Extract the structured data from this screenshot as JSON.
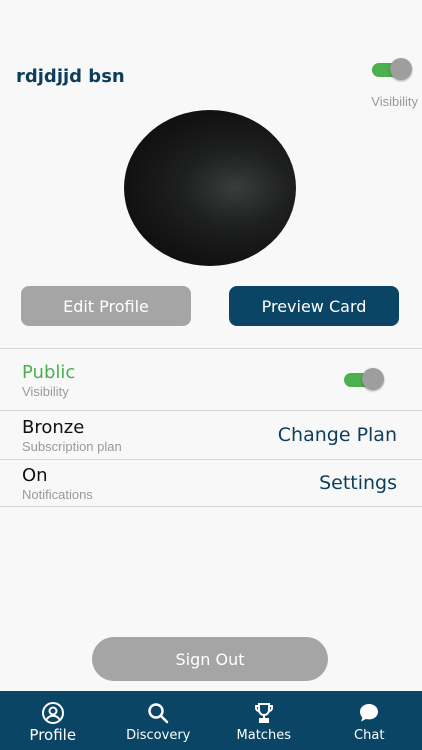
{
  "header": {
    "name": "rdjdjjd bsn",
    "visibility_label": "Visibility"
  },
  "actions": {
    "edit_profile": "Edit Profile",
    "preview_card": "Preview Card"
  },
  "settings": [
    {
      "title": "Public",
      "subtitle": "Visibility"
    },
    {
      "title": "Bronze",
      "subtitle": "Subscription plan",
      "action": "Change Plan"
    },
    {
      "title": "On",
      "subtitle": "Notifications",
      "action": "Settings"
    }
  ],
  "sign_out": "Sign Out",
  "nav": [
    {
      "label": "Profile",
      "icon": "profile-icon",
      "active": true
    },
    {
      "label": "Discovery",
      "icon": "search-icon"
    },
    {
      "label": "Matches",
      "icon": "trophy-icon"
    },
    {
      "label": "Chat",
      "icon": "chat-icon"
    }
  ],
  "colors": {
    "primary": "#0b4566",
    "accent_green": "#4caf50",
    "button_gray": "#a5a5a5"
  }
}
